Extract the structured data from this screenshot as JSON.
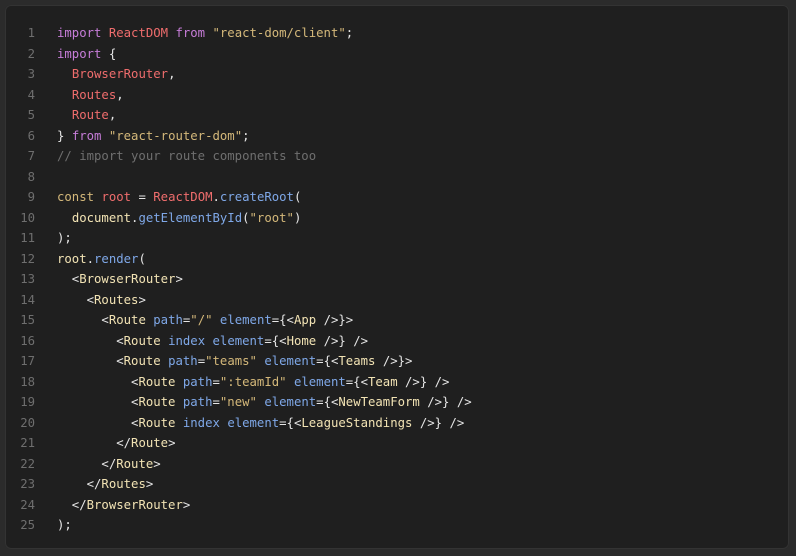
{
  "code": {
    "lines": [
      {
        "n": "1",
        "tokens": [
          [
            "kw2",
            "import"
          ],
          [
            "plain",
            " "
          ],
          [
            "ident",
            "ReactDOM"
          ],
          [
            "plain",
            " "
          ],
          [
            "kw2",
            "from"
          ],
          [
            "plain",
            " "
          ],
          [
            "string",
            "\"react-dom/client\""
          ],
          [
            "punct",
            ";"
          ]
        ]
      },
      {
        "n": "2",
        "tokens": [
          [
            "kw2",
            "import"
          ],
          [
            "plain",
            " {"
          ]
        ]
      },
      {
        "n": "3",
        "tokens": [
          [
            "plain",
            "  "
          ],
          [
            "ident",
            "BrowserRouter"
          ],
          [
            "punct",
            ","
          ]
        ]
      },
      {
        "n": "4",
        "tokens": [
          [
            "plain",
            "  "
          ],
          [
            "ident",
            "Routes"
          ],
          [
            "punct",
            ","
          ]
        ]
      },
      {
        "n": "5",
        "tokens": [
          [
            "plain",
            "  "
          ],
          [
            "ident",
            "Route"
          ],
          [
            "punct",
            ","
          ]
        ]
      },
      {
        "n": "6",
        "tokens": [
          [
            "punct",
            "} "
          ],
          [
            "kw2",
            "from"
          ],
          [
            "plain",
            " "
          ],
          [
            "string",
            "\"react-router-dom\""
          ],
          [
            "punct",
            ";"
          ]
        ]
      },
      {
        "n": "7",
        "tokens": [
          [
            "comment",
            "// import your route components too"
          ]
        ]
      },
      {
        "n": "8",
        "tokens": []
      },
      {
        "n": "9",
        "tokens": [
          [
            "keyword",
            "const"
          ],
          [
            "plain",
            " "
          ],
          [
            "ident",
            "root"
          ],
          [
            "plain",
            " = "
          ],
          [
            "ident",
            "ReactDOM"
          ],
          [
            "punct",
            "."
          ],
          [
            "func",
            "createRoot"
          ],
          [
            "punct",
            "("
          ]
        ]
      },
      {
        "n": "10",
        "tokens": [
          [
            "plain",
            "  "
          ],
          [
            "tag",
            "document"
          ],
          [
            "punct",
            "."
          ],
          [
            "func",
            "getElementById"
          ],
          [
            "punct",
            "("
          ],
          [
            "string",
            "\"root\""
          ],
          [
            "punct",
            ")"
          ]
        ]
      },
      {
        "n": "11",
        "tokens": [
          [
            "punct",
            ");"
          ]
        ]
      },
      {
        "n": "12",
        "tokens": [
          [
            "tag",
            "root"
          ],
          [
            "punct",
            "."
          ],
          [
            "func",
            "render"
          ],
          [
            "punct",
            "("
          ]
        ]
      },
      {
        "n": "13",
        "tokens": [
          [
            "plain",
            "  <"
          ],
          [
            "tag",
            "BrowserRouter"
          ],
          [
            "plain",
            ">"
          ]
        ]
      },
      {
        "n": "14",
        "tokens": [
          [
            "plain",
            "    <"
          ],
          [
            "tag",
            "Routes"
          ],
          [
            "plain",
            ">"
          ]
        ]
      },
      {
        "n": "15",
        "tokens": [
          [
            "plain",
            "      <"
          ],
          [
            "tag",
            "Route"
          ],
          [
            "plain",
            " "
          ],
          [
            "attr",
            "path"
          ],
          [
            "plain",
            "="
          ],
          [
            "string",
            "\"/\""
          ],
          [
            "plain",
            " "
          ],
          [
            "attr",
            "element"
          ],
          [
            "plain",
            "={<"
          ],
          [
            "tag",
            "App"
          ],
          [
            "plain",
            " />}>"
          ]
        ]
      },
      {
        "n": "16",
        "tokens": [
          [
            "plain",
            "        <"
          ],
          [
            "tag",
            "Route"
          ],
          [
            "plain",
            " "
          ],
          [
            "attr",
            "index"
          ],
          [
            "plain",
            " "
          ],
          [
            "attr",
            "element"
          ],
          [
            "plain",
            "={<"
          ],
          [
            "tag",
            "Home"
          ],
          [
            "plain",
            " />} />"
          ]
        ]
      },
      {
        "n": "17",
        "tokens": [
          [
            "plain",
            "        <"
          ],
          [
            "tag",
            "Route"
          ],
          [
            "plain",
            " "
          ],
          [
            "attr",
            "path"
          ],
          [
            "plain",
            "="
          ],
          [
            "string",
            "\"teams\""
          ],
          [
            "plain",
            " "
          ],
          [
            "attr",
            "element"
          ],
          [
            "plain",
            "={<"
          ],
          [
            "tag",
            "Teams"
          ],
          [
            "plain",
            " />}>"
          ]
        ]
      },
      {
        "n": "18",
        "tokens": [
          [
            "plain",
            "          <"
          ],
          [
            "tag",
            "Route"
          ],
          [
            "plain",
            " "
          ],
          [
            "attr",
            "path"
          ],
          [
            "plain",
            "="
          ],
          [
            "string",
            "\":teamId\""
          ],
          [
            "plain",
            " "
          ],
          [
            "attr",
            "element"
          ],
          [
            "plain",
            "={<"
          ],
          [
            "tag",
            "Team"
          ],
          [
            "plain",
            " />} />"
          ]
        ]
      },
      {
        "n": "19",
        "tokens": [
          [
            "plain",
            "          <"
          ],
          [
            "tag",
            "Route"
          ],
          [
            "plain",
            " "
          ],
          [
            "attr",
            "path"
          ],
          [
            "plain",
            "="
          ],
          [
            "string",
            "\"new\""
          ],
          [
            "plain",
            " "
          ],
          [
            "attr",
            "element"
          ],
          [
            "plain",
            "={<"
          ],
          [
            "tag",
            "NewTeamForm"
          ],
          [
            "plain",
            " />} />"
          ]
        ]
      },
      {
        "n": "20",
        "tokens": [
          [
            "plain",
            "          <"
          ],
          [
            "tag",
            "Route"
          ],
          [
            "plain",
            " "
          ],
          [
            "attr",
            "index"
          ],
          [
            "plain",
            " "
          ],
          [
            "attr",
            "element"
          ],
          [
            "plain",
            "={<"
          ],
          [
            "tag",
            "LeagueStandings"
          ],
          [
            "plain",
            " />} />"
          ]
        ]
      },
      {
        "n": "21",
        "tokens": [
          [
            "plain",
            "        </"
          ],
          [
            "tag",
            "Route"
          ],
          [
            "plain",
            ">"
          ]
        ]
      },
      {
        "n": "22",
        "tokens": [
          [
            "plain",
            "      </"
          ],
          [
            "tag",
            "Route"
          ],
          [
            "plain",
            ">"
          ]
        ]
      },
      {
        "n": "23",
        "tokens": [
          [
            "plain",
            "    </"
          ],
          [
            "tag",
            "Routes"
          ],
          [
            "plain",
            ">"
          ]
        ]
      },
      {
        "n": "24",
        "tokens": [
          [
            "plain",
            "  </"
          ],
          [
            "tag",
            "BrowserRouter"
          ],
          [
            "plain",
            ">"
          ]
        ]
      },
      {
        "n": "25",
        "tokens": [
          [
            "punct",
            ");"
          ]
        ]
      }
    ]
  },
  "colors": {
    "background": "#1f1f1f",
    "line_number": "#6e6e6e",
    "keyword": "#c77dd9",
    "identifier": "#ef6d6d",
    "string": "#d4b87a",
    "function": "#7fa8e8",
    "comment": "#6f6f6f",
    "tag": "#f2e3b4"
  }
}
